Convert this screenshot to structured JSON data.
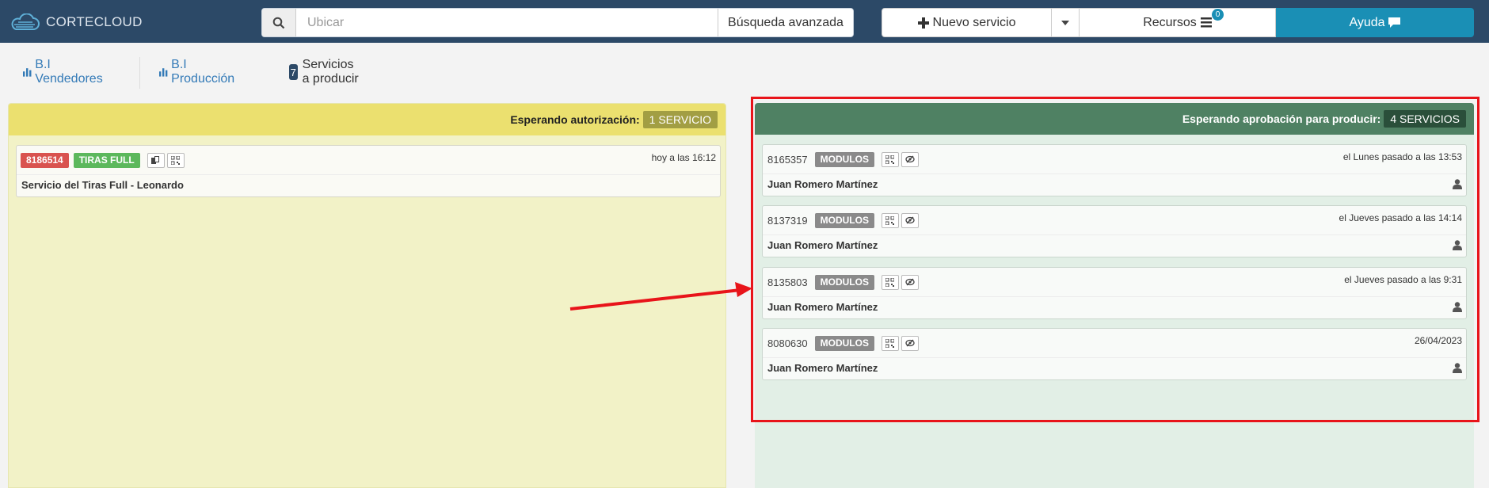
{
  "app": {
    "brand": "CORTECLOUD"
  },
  "search": {
    "placeholder": "Ubicar",
    "advanced_label": "Búsqueda avanzada"
  },
  "toolbar": {
    "new_service_label": "Nuevo servicio",
    "resources_label": "Recursos",
    "resources_badge": "0",
    "help_label": "Ayuda"
  },
  "subnav": {
    "bi_sellers": "B.I Vendedores",
    "bi_production": "B.I Producción",
    "services_count": "7",
    "services_label": "Servicios a producir"
  },
  "columns": {
    "left": {
      "title": "Esperando autorización:",
      "count_label": "1 SERVICIO",
      "cards": [
        {
          "id": "8186514",
          "tag1": "TIRAS FULL",
          "time": "hoy a las 16:12",
          "title": "Servicio del Tiras Full - Leonardo"
        }
      ]
    },
    "right": {
      "title": "Esperando aprobación para producir:",
      "count_label": "4 SERVICIOS",
      "cards": [
        {
          "id": "8165357",
          "tag": "MODULOS",
          "time": "el Lunes pasado a las 13:53",
          "title": "Juan Romero Martínez"
        },
        {
          "id": "8137319",
          "tag": "MODULOS",
          "time": "el Jueves pasado a las 14:14",
          "title": "Juan Romero Martínez"
        },
        {
          "id": "8135803",
          "tag": "MODULOS",
          "time": "el Jueves pasado a las 9:31",
          "title": "Juan Romero Martínez"
        },
        {
          "id": "8080630",
          "tag": "MODULOS",
          "time": "26/04/2023",
          "title": "Juan Romero Martínez"
        }
      ]
    }
  },
  "colors": {
    "navbar": "#2c4967",
    "help_button": "#1a8fb5",
    "left_header": "#ebe06f",
    "right_header": "#4f8163",
    "highlight": "#e8141a"
  }
}
